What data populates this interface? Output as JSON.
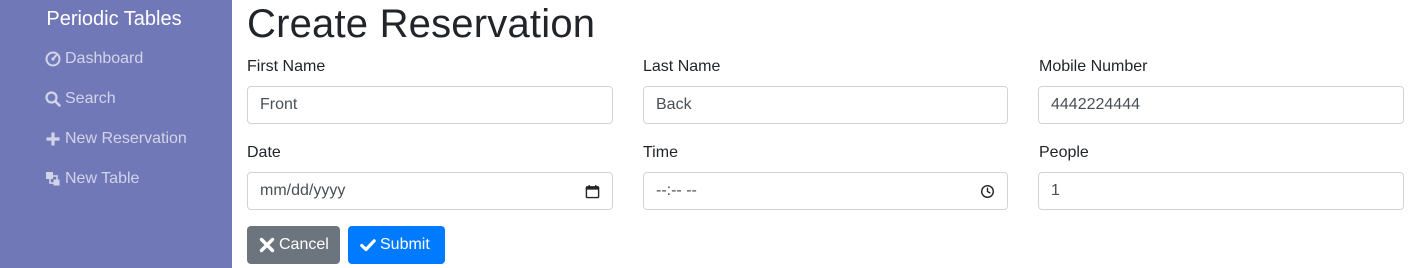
{
  "sidebar": {
    "brand": "Periodic Tables",
    "items": [
      {
        "label": "Dashboard",
        "icon": "dashboard-icon"
      },
      {
        "label": "Search",
        "icon": "search-icon"
      },
      {
        "label": "New Reservation",
        "icon": "plus-icon"
      },
      {
        "label": "New Table",
        "icon": "layers-icon"
      }
    ]
  },
  "page": {
    "title": "Create Reservation"
  },
  "form": {
    "first_name": {
      "label": "First Name",
      "value": "Front"
    },
    "last_name": {
      "label": "Last Name",
      "value": "Back"
    },
    "mobile_number": {
      "label": "Mobile Number",
      "value": "4442224444"
    },
    "date": {
      "label": "Date",
      "value": "mm/dd/yyyy"
    },
    "time": {
      "label": "Time",
      "value": "--:-- --"
    },
    "people": {
      "label": "People",
      "value": "1"
    }
  },
  "buttons": {
    "cancel": "Cancel",
    "submit": "Submit"
  },
  "colors": {
    "sidebar_bg": "#7178b8",
    "cancel_bg": "#6c757d",
    "submit_bg": "#007bff"
  }
}
